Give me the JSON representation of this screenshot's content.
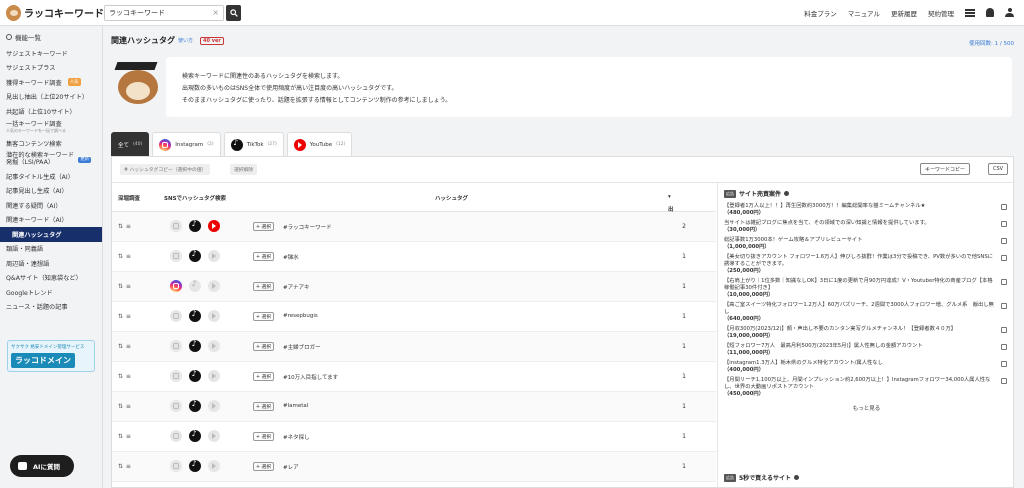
{
  "header": {
    "logo_text": "ラッコキーワード",
    "search_value": "ラッコキーワード",
    "links": [
      "料金プラン",
      "マニュアル",
      "更新履歴",
      "契約管理"
    ]
  },
  "sidebar": {
    "heading": "機能一覧",
    "items": [
      {
        "label": "サジェストキーワード"
      },
      {
        "label": "サジェストプラス"
      },
      {
        "label": "獲得キーワード調査",
        "badge": "人気"
      },
      {
        "label": "見出し抽出（上位20サイト）"
      },
      {
        "label": "共起語（上位10サイト）"
      },
      {
        "label": "一括キーワード調査",
        "sub": "人気のキーワードを一括で調べる"
      },
      {
        "label": "集客コンテンツ検索"
      },
      {
        "label": "潜在的な検索キーワード",
        "label2": "発掘（LSI/PAA）",
        "badge": "更新"
      },
      {
        "label": "記事タイトル生成（AI）"
      },
      {
        "label": "記事見出し生成（AI）"
      },
      {
        "label": "関連する疑問（AI）"
      },
      {
        "label": "関連キーワード（AI）"
      },
      {
        "label": "関連ハッシュタグ",
        "active": true
      },
      {
        "label": "類語・同義語"
      },
      {
        "label": "周辺語・連想語"
      },
      {
        "label": "Q&Aサイト（知恵袋など）"
      },
      {
        "label": "Googleトレンド"
      },
      {
        "label": "ニュース・話題の記事"
      }
    ],
    "banner_top": "サクサク 格安ドメイン管理サービス",
    "banner_main": "ラッコドメイン",
    "ai_button": "AIに質問"
  },
  "page": {
    "title": "関連ハッシュタグ",
    "how_to": "使い方",
    "count_badge": "40 ver",
    "usage": "使用回数: 1 / 500",
    "intro": [
      "検索キーワードに関連性のあるハッシュタグを検索します。",
      "出現数の多いものはSNS全体で使用頻度が高い注目度の高いハッシュタグです。",
      "そのままハッシュタグに使ったり、話題を拡張する情報としてコンテンツ制作の参考にしましょう。"
    ]
  },
  "tabs": [
    {
      "label": "全て",
      "count": "(40)",
      "icon": "",
      "active": true
    },
    {
      "label": "Instagram",
      "count": "(2)",
      "icon": "ig"
    },
    {
      "label": "TikTok",
      "count": "(27)",
      "icon": "tt"
    },
    {
      "label": "YouTube",
      "count": "(12)",
      "icon": "yt"
    }
  ],
  "actions": {
    "copy_hashtags": "# ハッシュタグコピー（選択中の値）",
    "clear_selection": "選択解除",
    "keyword_copy": "キーワードコピー",
    "csv": "CSV"
  },
  "table": {
    "columns": {
      "details": "深堀調査",
      "sns": "SNSでハッシュタグ検索",
      "hashtag": "ハッシュタグ",
      "count": "出現数"
    },
    "select_label": "+ 選択",
    "rows": [
      {
        "tag": "#ラッコキーワード",
        "count": "2",
        "icons": [
          "off",
          "on",
          "on"
        ]
      },
      {
        "tag": "#锑水",
        "count": "1",
        "icons": [
          "off",
          "on",
          "off"
        ]
      },
      {
        "tag": "#アナアキ",
        "count": "1",
        "icons": [
          "on",
          "off",
          "off"
        ]
      },
      {
        "tag": "#resepbugis",
        "count": "1",
        "icons": [
          "off",
          "on",
          "off"
        ]
      },
      {
        "tag": "#主婦ブロガー",
        "count": "1",
        "icons": [
          "off",
          "on",
          "off"
        ]
      },
      {
        "tag": "#10万入目指してます",
        "count": "1",
        "icons": [
          "off",
          "on",
          "off"
        ]
      },
      {
        "tag": "#lametal",
        "count": "1",
        "icons": [
          "off",
          "on",
          "off"
        ]
      },
      {
        "tag": "#ネタ探し",
        "count": "1",
        "icons": [
          "off",
          "on",
          "off"
        ]
      },
      {
        "tag": "#レア",
        "count": "1",
        "icons": [
          "off",
          "on",
          "off"
        ]
      }
    ]
  },
  "side_panel": {
    "label": "広告",
    "title": "サイト売買案件",
    "items": [
      {
        "text": "【登録者1万人以上！！】再生回数約3000万！！編集総開率な猫ミームチャンネル★",
        "price": "（480,000円）"
      },
      {
        "text": "当サイトは雑記ブログに焦点を当て、その領域での深い知識と情報を提供しています。",
        "price": "（30,000円）"
      },
      {
        "text": "総記事数1万3000本！ゲーム攻略＆アプリレビューサイト",
        "price": "（1,000,000円）"
      },
      {
        "text": "【美女切り抜きアカウント フォロワー1.6万人】伸びしろ抜群！作業は3分で投稿でき、PV数が多いので他SNSに誘導することができます。",
        "price": "（250,000円）"
      },
      {
        "text": "【右肩上がり｜1位多数｜知識なしOK】3日に1度の更新で月90万円達成！V・Youtuber特化の商産ブログ【本格稼働記事30件付き】",
        "price": "（10,000,000円）"
      },
      {
        "text": "【高ご室スイーツ特化フォロワー1.2万人】60万バズリーチ、2週間で3000人フォロワー増、グルメ系　飯出し無し",
        "price": "（640,000円）"
      },
      {
        "text": "【月収300万(2023/12)】顔・声出し不要のカンタン実写グルメチャンネル！【登録者数４０万】",
        "price": "（19,000,000円）"
      },
      {
        "text": "【短フォロワー7万人　最高月利500万(2023年5月)】属人性無しの金額アカウント",
        "price": "（11,000,000円）"
      },
      {
        "text": "【instagram1.3万人】栃木県のグルメ特化アカウント/属人性なし",
        "price": "（400,000円）"
      },
      {
        "text": "【月間リーチ1,100万以上、月間インプレッション約2,600万以上！】Instagramフォロワー34,000人属人性なし、世界の大動画リポストアカウント",
        "price": "（450,000円）"
      }
    ],
    "more": "もっと見る",
    "label2": "広告",
    "title2": "5秒で買えるサイト"
  }
}
